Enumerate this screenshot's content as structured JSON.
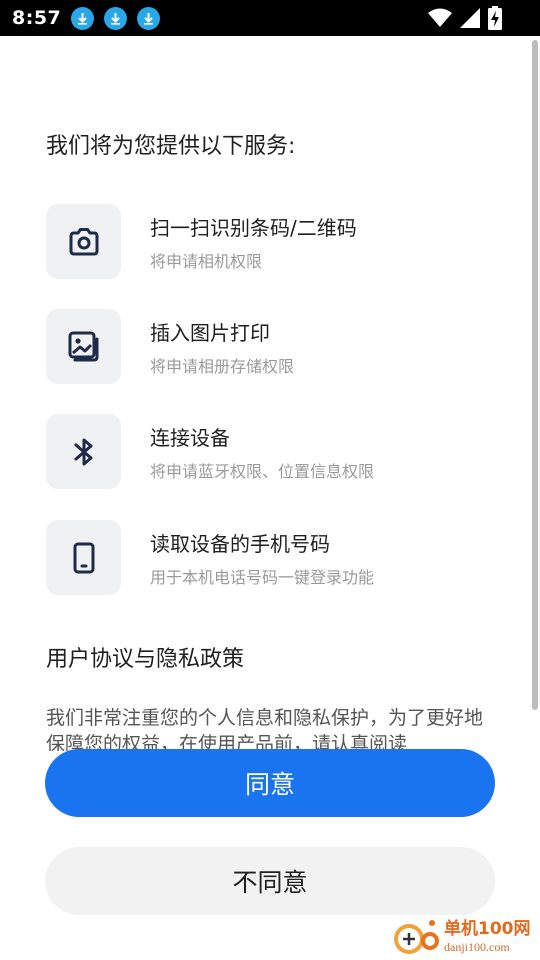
{
  "status_bar": {
    "time": "8:57",
    "notification_icons": [
      "download-icon",
      "download-icon",
      "download-icon"
    ],
    "right_icons": [
      "wifi-icon",
      "signal-icon",
      "battery-charging-icon"
    ]
  },
  "heading": "我们将为您提供以下服务:",
  "services": [
    {
      "icon": "camera-icon",
      "title": "扫一扫识别条码/二维码",
      "desc": "将申请相机权限"
    },
    {
      "icon": "gallery-icon",
      "title": "插入图片打印",
      "desc": "将申请相册存储权限"
    },
    {
      "icon": "bluetooth-icon",
      "title": "连接设备",
      "desc": "将申请蓝牙权限、位置信息权限"
    },
    {
      "icon": "phone-icon",
      "title": "读取设备的手机号码",
      "desc": "用于本机电话号码一键登录功能"
    }
  ],
  "policy": {
    "title": "用户协议与隐私政策",
    "text": "我们非常注重您的个人信息和隐私保护，为了更好地保障您的权益，在使用产品前，请认真阅读"
  },
  "buttons": {
    "agree": "同意",
    "disagree": "不同意"
  },
  "watermark": {
    "cn": "单机100网",
    "en": "danji100.com"
  },
  "colors": {
    "primary": "#1b74ef",
    "icon_tile": "#f0f1f3",
    "icon_stroke": "#1e2a4a",
    "secondary_text": "#9a9a9a"
  }
}
